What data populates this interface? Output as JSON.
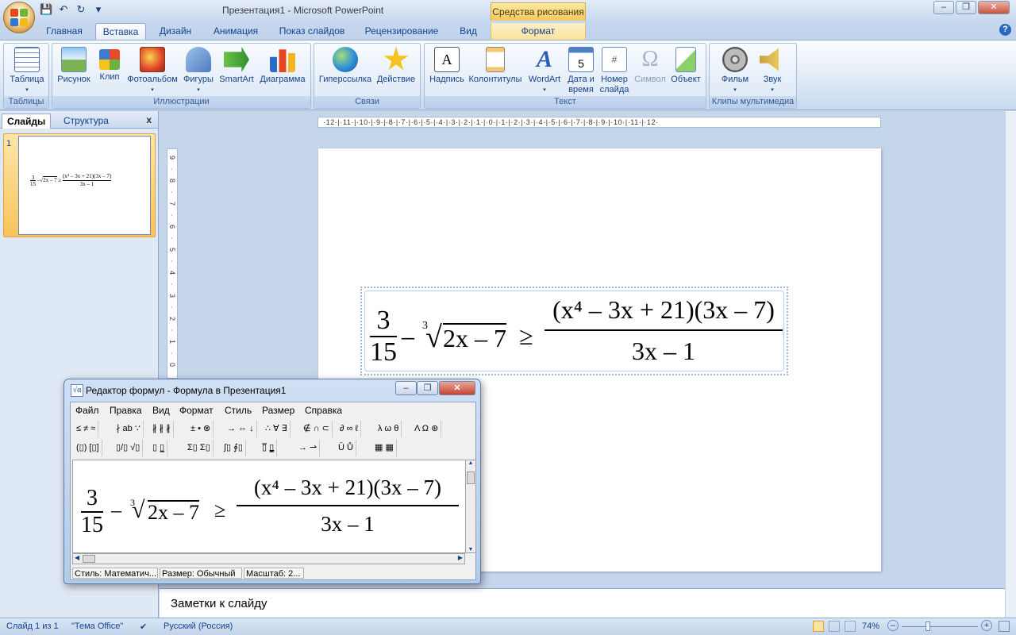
{
  "window": {
    "title": "Презентация1 - Microsoft PowerPoint",
    "context_tab_title": "Средства рисования"
  },
  "tabs": [
    "Главная",
    "Вставка",
    "Дизайн",
    "Анимация",
    "Показ слайдов",
    "Рецензирование",
    "Вид",
    "Формат"
  ],
  "active_tab": "Вставка",
  "ribbon": {
    "groups": {
      "tables": "Таблицы",
      "illustrations": "Иллюстрации",
      "links": "Связи",
      "text": "Текст",
      "media": "Клипы мультимедиа"
    },
    "buttons": {
      "table": "Таблица",
      "picture": "Рисунок",
      "clip": "Клип",
      "photo_album": "Фотоальбом",
      "shapes": "Фигуры",
      "smartart": "SmartArt",
      "chart": "Диаграмма",
      "hyperlink": "Гиперссылка",
      "action": "Действие",
      "textbox": "Надпись",
      "header_footer": "Колонтитулы",
      "wordart": "WordArt",
      "date_time_1": "Дата и",
      "date_time_2": "время",
      "slide_number_1": "Номер",
      "slide_number_2": "слайда",
      "symbol": "Символ",
      "object": "Объект",
      "movie": "Фильм",
      "sound": "Звук"
    }
  },
  "left_pane": {
    "tab_slides": "Слайды",
    "tab_outline": "Структура",
    "close": "x",
    "slide_number": "1"
  },
  "ruler": {
    "horizontal": "·12·|·11·|·10·|·9·|·8·|·7·|·6·|·5·|·4·|·3·|·2·|·1·|·0·|·1·|·2·|·3·|·4·|·5·|·6·|·7·|·8·|·9·|·10·|·11·|·12·",
    "vertical": "9 · 8 · 7 · 6 · 5 · 4 · 3 · 2 · 1 · 0"
  },
  "formula": {
    "num_small": "3",
    "den_small": "15",
    "minus": "–",
    "root_index": "3",
    "radicand": "2x – 7",
    "geq": "≥",
    "big_num": "(x⁴ – 3x + 21)(3x – 7)",
    "big_den": "3x – 1"
  },
  "notes": {
    "placeholder": "Заметки к слайду"
  },
  "statusbar": {
    "slide": "Слайд 1 из 1",
    "theme": "\"Тема Office\"",
    "language": "Русский (Россия)",
    "zoom": "74%"
  },
  "equation_editor": {
    "title": "Редактор формул - Формула в Презентация1",
    "menu": [
      "Файл",
      "Правка",
      "Вид",
      "Формат",
      "Стиль",
      "Размер",
      "Справка"
    ],
    "toolbar_row1": [
      "≤ ≠ ≈",
      "∤ ab ∵",
      "∦ ∦ ∦",
      "± • ⊗",
      "→ ⇔ ↓",
      "∴ ∀ ∃",
      "∉ ∩ ⊂",
      "∂ ∞ ℓ",
      "λ ω θ",
      "Λ Ω ⊛"
    ],
    "toolbar_row2": [
      "(▯) [▯]",
      "▯/▯ √▯",
      "▯ ▯̲",
      "Σ▯ Σ▯",
      "∫▯ ∮▯",
      "▯̅ ▯̳",
      "→ ⇀",
      "Ū Ů",
      "▦ ▦"
    ],
    "status_style": "Стиль: Математич...",
    "status_size": "Размер: Обычный",
    "status_zoom": "Масштаб: 2..."
  }
}
